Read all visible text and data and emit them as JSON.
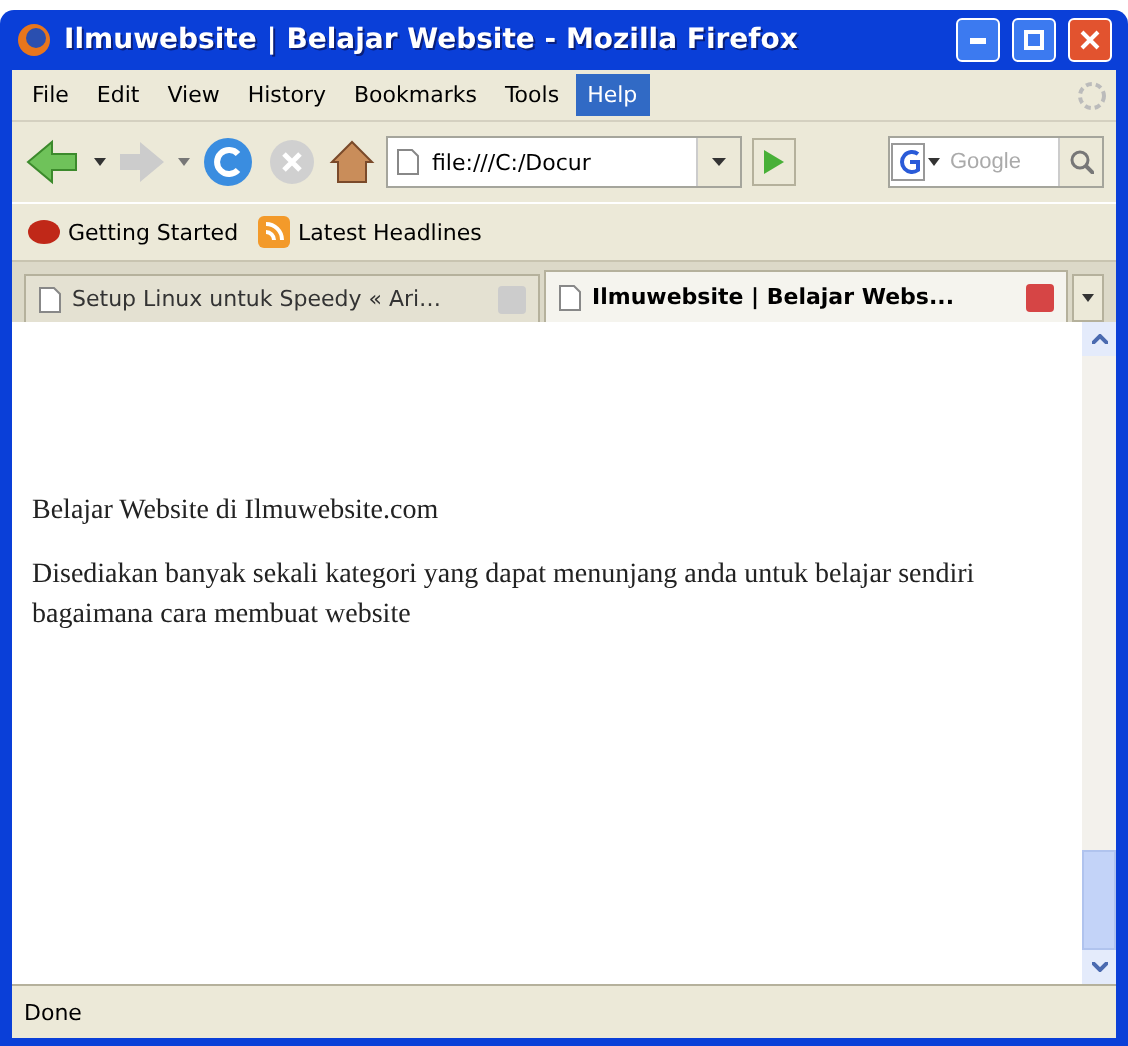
{
  "window": {
    "title": "Ilmuwebsite | Belajar Website - Mozilla Firefox"
  },
  "menu": [
    {
      "label": "File",
      "selected": false
    },
    {
      "label": "Edit",
      "selected": false
    },
    {
      "label": "View",
      "selected": false
    },
    {
      "label": "History",
      "selected": false
    },
    {
      "label": "Bookmarks",
      "selected": false
    },
    {
      "label": "Tools",
      "selected": false
    },
    {
      "label": "Help",
      "selected": true
    }
  ],
  "address": {
    "value": "file:///C:/Docur"
  },
  "search": {
    "placeholder": "Google"
  },
  "bookmarks": [
    {
      "label": "Getting Started",
      "kind": "firefox"
    },
    {
      "label": "Latest Headlines",
      "kind": "rss"
    }
  ],
  "tabs": [
    {
      "label": "Setup Linux untuk Speedy « Ari…",
      "selected": false
    },
    {
      "label": "Ilmuwebsite | Belajar Webs...",
      "selected": true
    }
  ],
  "content": {
    "heading": "Belajar Website di Ilmuwebsite.com",
    "paragraph": "Disediakan banyak sekali kategori yang dapat menunjang anda untuk belajar sendiri bagaimana cara membuat website"
  },
  "status_bar": {
    "text": "Done"
  }
}
